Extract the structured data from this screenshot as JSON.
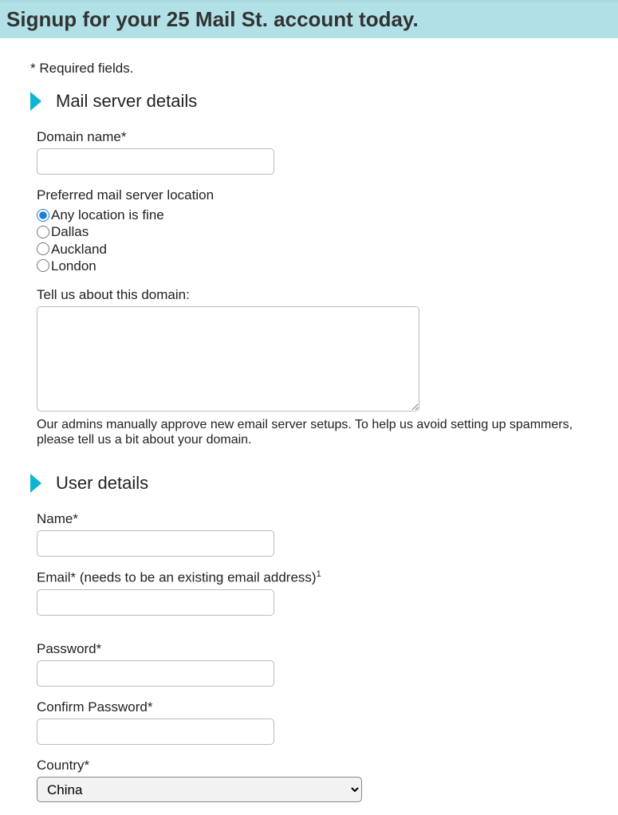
{
  "banner": {
    "title": "Signup for your 25 Mail St. account today."
  },
  "requiredNote": "* Required fields.",
  "sections": {
    "mailServer": {
      "title": "Mail server details",
      "domainName": {
        "label": "Domain name*",
        "value": ""
      },
      "location": {
        "label": "Preferred mail server location",
        "options": {
          "any": "Any location is fine",
          "dallas": "Dallas",
          "auckland": "Auckland",
          "london": "London"
        },
        "selected": "any"
      },
      "about": {
        "label": "Tell us about this domain:",
        "value": "",
        "hint": "Our admins manually approve new email server setups. To help us avoid setting up spammers, please tell us a bit about your domain."
      }
    },
    "userDetails": {
      "title": "User details",
      "name": {
        "label": "Name*",
        "value": ""
      },
      "email": {
        "label": "Email* (needs to be an existing email address)",
        "sup": "1",
        "value": ""
      },
      "password": {
        "label": "Password*",
        "value": ""
      },
      "confirmPassword": {
        "label": "Confirm Password*",
        "value": ""
      },
      "country": {
        "label": "Country*",
        "selected": "China"
      }
    }
  }
}
